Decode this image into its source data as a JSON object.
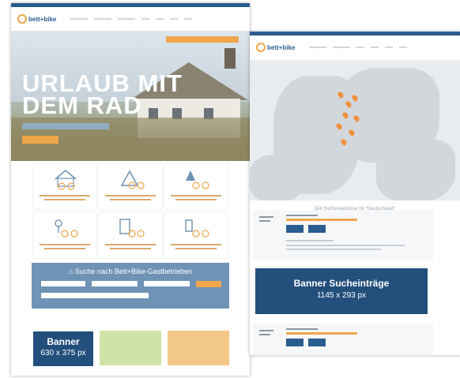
{
  "left_page": {
    "hero_title_line1": "URLAUB MIT",
    "hero_title_line2": "DEM RAD",
    "search_title": "Suche nach Bett+Bike-Gastbetrieben"
  },
  "logo_text": "bett+bike",
  "banner_label": {
    "title": "Banner",
    "size": "630 x 375 px"
  },
  "right_page": {
    "map_caption": "504 Suchergebnisse für \"Deutschland\""
  },
  "search_entries_label": {
    "title": "Banner Sucheinträge",
    "size": "1145 x 293 px"
  },
  "colors": {
    "brand_blue": "#2a5d8f",
    "label_blue": "#234f7c",
    "accent_orange": "#f0a64a",
    "search_blue": "#6e93b5"
  }
}
